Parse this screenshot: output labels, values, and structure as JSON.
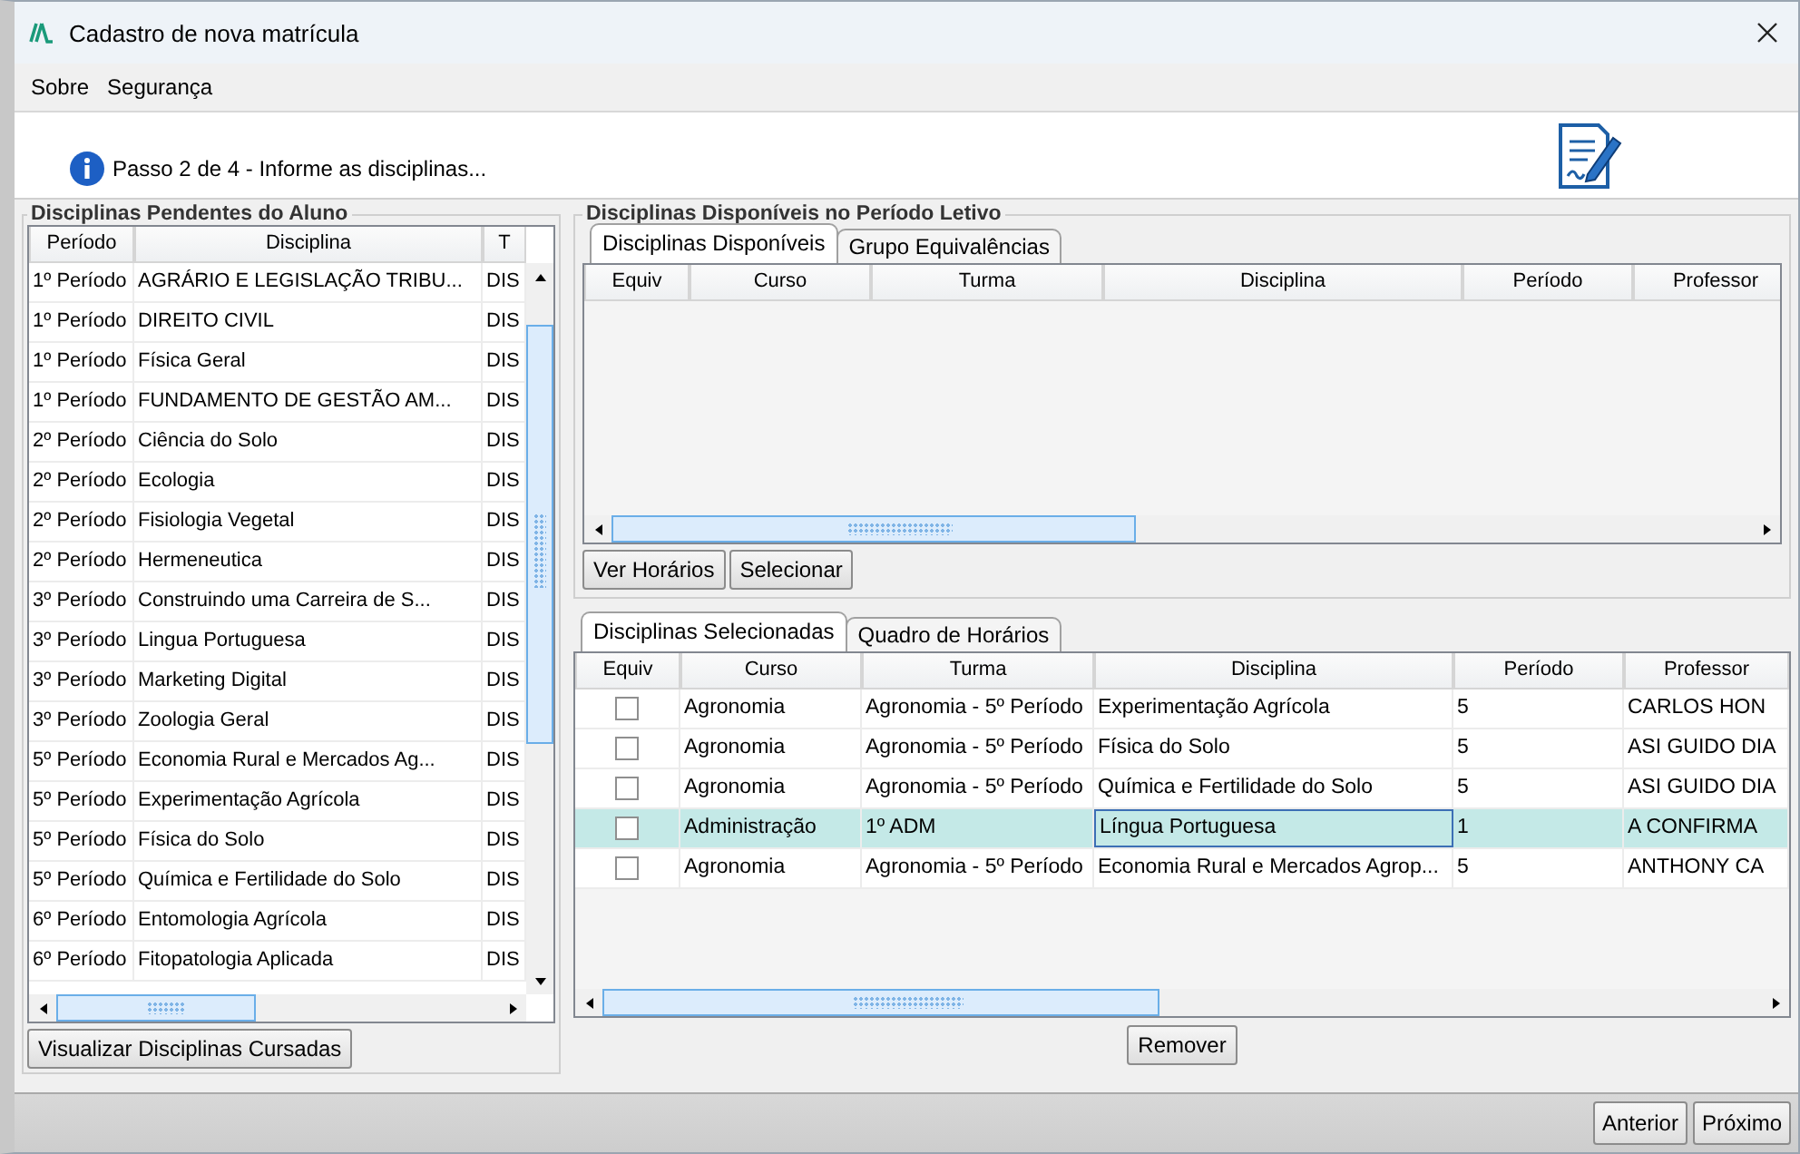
{
  "window": {
    "title": "Cadastro de nova matrícula"
  },
  "menu": [
    {
      "label": "Sobre"
    },
    {
      "label": "Segurança"
    }
  ],
  "step": {
    "text": "Passo 2 de 4 - Informe as disciplinas..."
  },
  "pending": {
    "title": "Disciplinas Pendentes do Aluno",
    "columns": [
      "Período",
      "Disciplina",
      "T"
    ],
    "rows": [
      [
        "1º Período",
        "AGRÁRIO E LEGISLAÇÃO TRIBU...",
        "DIS"
      ],
      [
        "1º Período",
        "DIREITO CIVIL",
        "DIS"
      ],
      [
        "1º Período",
        "Física Geral",
        "DIS"
      ],
      [
        "1º Período",
        "FUNDAMENTO DE GESTÃO AM...",
        "DIS"
      ],
      [
        "2º Período",
        "Ciência do Solo",
        "DIS"
      ],
      [
        "2º Período",
        "Ecologia",
        "DIS"
      ],
      [
        "2º Período",
        "Fisiologia Vegetal",
        "DIS"
      ],
      [
        "2º Período",
        "Hermeneutica",
        "DIS"
      ],
      [
        "3º Período",
        "Construindo uma Carreira de S...",
        "DIS"
      ],
      [
        "3º Período",
        "Lingua Portuguesa",
        "DIS"
      ],
      [
        "3º Período",
        "Marketing Digital",
        "DIS"
      ],
      [
        "3º Período",
        "Zoologia Geral",
        "DIS"
      ],
      [
        "5º Período",
        "Economia Rural e Mercados Ag...",
        "DIS"
      ],
      [
        "5º Período",
        "Experimentação Agrícola",
        "DIS"
      ],
      [
        "5º Período",
        "Física do Solo",
        "DIS"
      ],
      [
        "5º Período",
        "Química e Fertilidade do Solo",
        "DIS"
      ],
      [
        "6º Período",
        "Entomologia Agrícola",
        "DIS"
      ],
      [
        "6º Período",
        "Fitopatologia Aplicada",
        "DIS"
      ]
    ],
    "button": "Visualizar Disciplinas Cursadas"
  },
  "available": {
    "title": "Disciplinas Disponíveis no Período Letivo",
    "tabs": [
      {
        "label": "Disciplinas Disponíveis",
        "selected": true
      },
      {
        "label": "Grupo Equivalências",
        "selected": false
      }
    ],
    "columns": [
      "Equiv",
      "Curso",
      "Turma",
      "Disciplina",
      "Período",
      "Professor"
    ],
    "buttons": [
      "Ver Horários",
      "Selecionar"
    ]
  },
  "chosen": {
    "tabs": [
      {
        "label": "Disciplinas Selecionadas",
        "selected": true
      },
      {
        "label": "Quadro de Horários",
        "selected": false
      }
    ],
    "columns": [
      "Equiv",
      "Curso",
      "Turma",
      "Disciplina",
      "Período",
      "Professor"
    ],
    "rows": [
      {
        "checked": false,
        "selected": false,
        "cells": [
          "",
          "Agronomia",
          "Agronomia - 5º Período",
          "Experimentação Agrícola",
          "5",
          "CARLOS HON"
        ]
      },
      {
        "checked": false,
        "selected": false,
        "cells": [
          "",
          "Agronomia",
          "Agronomia - 5º Período",
          "Física do Solo",
          "5",
          "ASI GUIDO DIA"
        ]
      },
      {
        "checked": false,
        "selected": false,
        "cells": [
          "",
          "Agronomia",
          "Agronomia - 5º Período",
          "Química e Fertilidade do Solo",
          "5",
          "ASI GUIDO DIA"
        ]
      },
      {
        "checked": false,
        "selected": true,
        "cells": [
          "",
          "Administração",
          "1º ADM",
          "Língua Portuguesa",
          "1",
          "A CONFIRMA"
        ]
      },
      {
        "checked": false,
        "selected": false,
        "cells": [
          "",
          "Agronomia",
          "Agronomia - 5º Período",
          "Economia Rural e Mercados Agrop...",
          "5",
          "ANTHONY CA"
        ]
      }
    ],
    "button": "Remover"
  },
  "footer": {
    "buttons": [
      "Anterior",
      "Próximo"
    ]
  }
}
